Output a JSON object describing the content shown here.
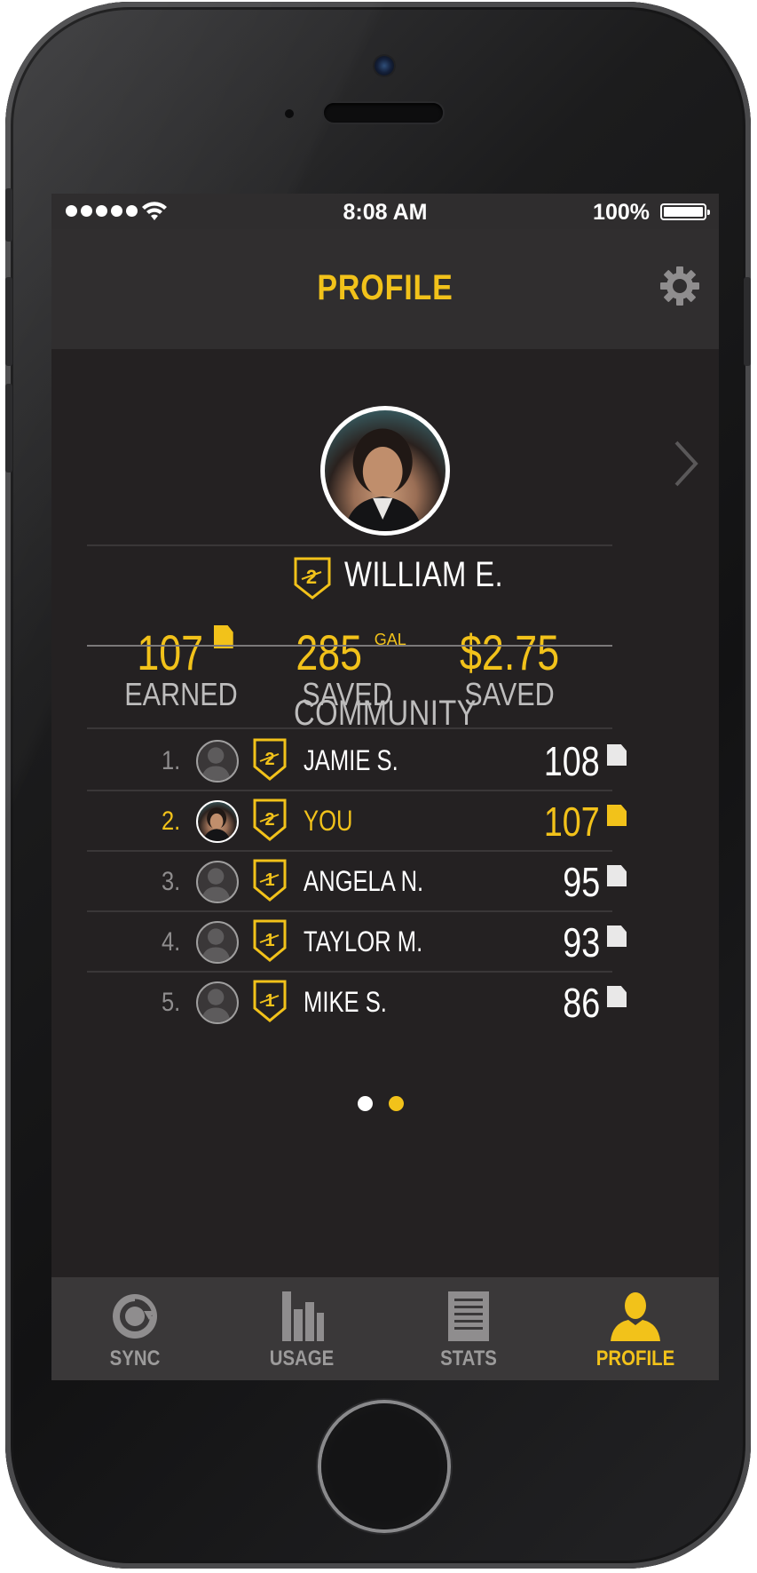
{
  "status_bar": {
    "time": "8:08 AM",
    "battery": "100%"
  },
  "nav": {
    "title": "PROFILE"
  },
  "profile": {
    "name": "WILLIAM E.",
    "badge_level": "2"
  },
  "stats": [
    {
      "value": "107",
      "label": "EARNED",
      "unit": ""
    },
    {
      "value": "285",
      "label": "SAVED",
      "unit": "GAL"
    },
    {
      "value": "$2.75",
      "label": "SAVED",
      "unit": ""
    }
  ],
  "community": {
    "title": "COMMUNITY",
    "rows": [
      {
        "rank": "1.",
        "name": "JAMIE S.",
        "score": "108",
        "badge_level": "2"
      },
      {
        "rank": "2.",
        "name": "YOU",
        "score": "107",
        "badge_level": "2"
      },
      {
        "rank": "3.",
        "name": "ANGELA N.",
        "score": "95",
        "badge_level": "1"
      },
      {
        "rank": "4.",
        "name": "TAYLOR M.",
        "score": "93",
        "badge_level": "1"
      },
      {
        "rank": "5.",
        "name": "MIKE S.",
        "score": "86",
        "badge_level": "1"
      }
    ]
  },
  "pagination": {
    "total": 2,
    "active": 2
  },
  "tabs": [
    {
      "label": "SYNC",
      "icon": "sync-icon"
    },
    {
      "label": "USAGE",
      "icon": "bar-chart-icon"
    },
    {
      "label": "STATS",
      "icon": "document-icon"
    },
    {
      "label": "PROFILE",
      "icon": "person-icon"
    }
  ],
  "colors": {
    "accent": "#f2c21a",
    "background": "#242122",
    "muted": "#bdbcbc"
  }
}
